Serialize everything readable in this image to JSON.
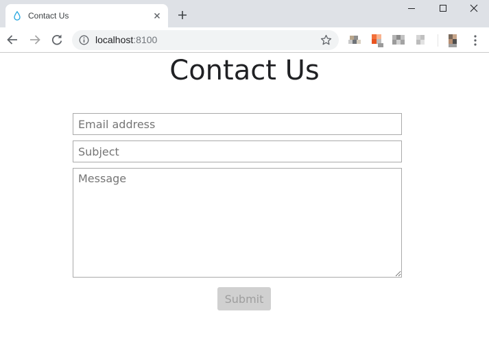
{
  "browser": {
    "tab": {
      "title": "Contact Us",
      "favicon": "water-drop-icon"
    },
    "address_bar": {
      "host": "localhost",
      "port": ":8100"
    },
    "icons": {
      "back": "arrow-left-icon",
      "forward": "arrow-right-icon",
      "reload": "reload-icon",
      "info": "info-icon",
      "bookmark": "star-icon",
      "menu": "kebab-menu-icon",
      "new_tab": "plus-icon",
      "close_tab": "close-icon"
    },
    "colors": {
      "tabstrip": "#dee1e6",
      "omnibox": "#f1f3f4",
      "favicon": "#29a8e0"
    }
  },
  "page": {
    "title": "Contact Us",
    "form": {
      "email_placeholder": "Email address",
      "subject_placeholder": "Subject",
      "message_placeholder": "Message",
      "submit_label": "Submit"
    },
    "colors": {
      "submit_background": "#d0d0d0",
      "submit_text": "#9e9e9e",
      "field_border": "#a9a9a9"
    }
  }
}
